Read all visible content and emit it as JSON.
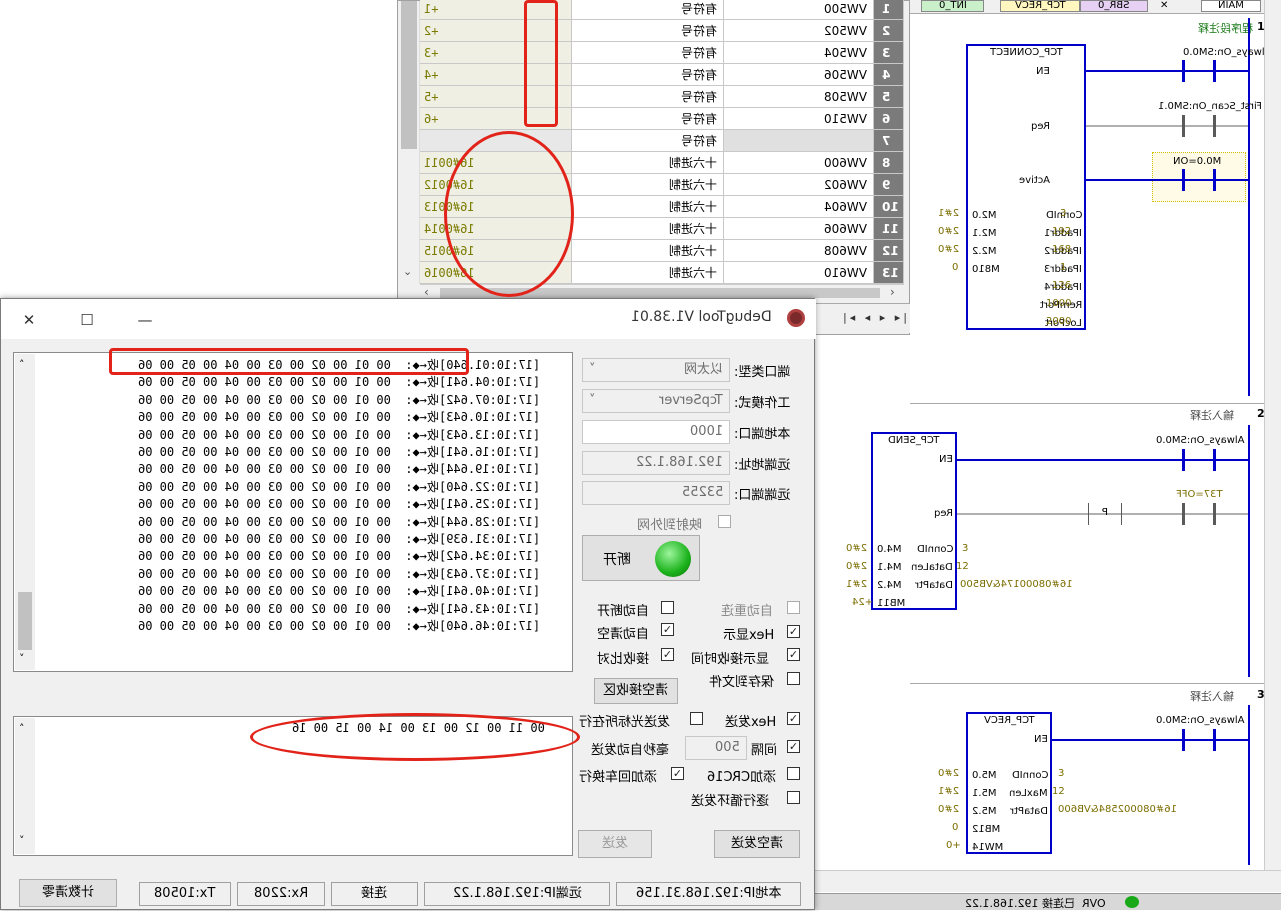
{
  "var_table": {
    "rows": [
      {
        "num": "1",
        "addr": "VW500",
        "fmt": "有符号",
        "val": "+1"
      },
      {
        "num": "2",
        "addr": "VW502",
        "fmt": "有符号",
        "val": "+2"
      },
      {
        "num": "3",
        "addr": "VW504",
        "fmt": "有符号",
        "val": "+3"
      },
      {
        "num": "4",
        "addr": "VW506",
        "fmt": "有符号",
        "val": "+4"
      },
      {
        "num": "5",
        "addr": "VW508",
        "fmt": "有符号",
        "val": "+5"
      },
      {
        "num": "6",
        "addr": "VW510",
        "fmt": "有符号",
        "val": "+6"
      },
      {
        "num": "7",
        "addr": "",
        "fmt": "有符号",
        "val": ""
      },
      {
        "num": "8",
        "addr": "VW600",
        "fmt": "十六进制",
        "val": "16#0011"
      },
      {
        "num": "9",
        "addr": "VW602",
        "fmt": "十六进制",
        "val": "16#0012"
      },
      {
        "num": "10",
        "addr": "VW604",
        "fmt": "十六进制",
        "val": "16#0013"
      },
      {
        "num": "11",
        "addr": "VW606",
        "fmt": "十六进制",
        "val": "16#0014"
      },
      {
        "num": "12",
        "addr": "VW608",
        "fmt": "十六进制",
        "val": "16#0015"
      },
      {
        "num": "13",
        "addr": "VW610",
        "fmt": "十六进制",
        "val": "16#0016"
      }
    ],
    "nav_glyphs": "|◂ ◂ ▸ ▸|"
  },
  "ladder": {
    "tabs": [
      "MAIN",
      "INT_0",
      "TCP_RECV",
      "SBR_0"
    ],
    "networks": [
      {
        "num": "1",
        "comment": "程序段注释",
        "block": "TCP_CONNECT",
        "always": "Always_On:SM0.0",
        "first": "First_Scan_On:SM0.1",
        "m_on": "M0.0=ON",
        "pins": [
          "EN",
          "Req",
          "Active",
          "ConnID",
          "IPaddr1",
          "IPaddr2",
          "IPaddr3",
          "IPaddr4",
          "RemPort",
          "LocPort"
        ],
        "inputs": [
          "3",
          "192",
          "168",
          "1",
          "126",
          "1000",
          "2000"
        ],
        "outputs": [
          "M2.0",
          "M2.1",
          "M2.2",
          "M810"
        ],
        "out_vals": [
          "2#1",
          "2#0",
          "2#0",
          "0"
        ]
      },
      {
        "num": "2",
        "comment": "输入注释",
        "block": "TCP_SEND",
        "always": "Always_On:SM0.0",
        "t37": "T37=OFF",
        "p": "P",
        "pins": [
          "EN",
          "Req",
          "ConnID",
          "DataLen",
          "DataPtr"
        ],
        "inputs": [
          "3",
          "12",
          "16#08000174&VB500"
        ],
        "outputs": [
          "M4.0",
          "M4.1",
          "M4.2",
          "MB11"
        ],
        "out_vals": [
          "2#0",
          "2#0",
          "2#1",
          "+24"
        ]
      },
      {
        "num": "3",
        "comment": "输入注释",
        "block": "TCP_RECV",
        "always": "Always_On:SM0.0",
        "pins": [
          "EN",
          "ConnID",
          "MaxLen",
          "DataPtr"
        ],
        "inputs": [
          "3",
          "12",
          "16#080002584&VB600"
        ],
        "outputs": [
          "M5.0",
          "M5.1",
          "M5.2",
          "MB12",
          "MW14"
        ],
        "out_vals": [
          "2#0",
          "2#1",
          "2#0",
          "0",
          "+0"
        ]
      }
    ],
    "status_bar": "OVR  已连接 192.168.1.22"
  },
  "debug": {
    "title": "DebugTool V1.38.01",
    "minimize": "—",
    "maximize": "☐",
    "close": "✕",
    "rx_lines": [
      "[17:10:01.640]收←◆:  00 01 00 02 00 03 00 04 00 05 00 06",
      "[17:10:04.641]收←◆:  00 01 00 02 00 03 00 04 00 05 00 06",
      "[17:10:07.642]收←◆:  00 01 00 02 00 03 00 04 00 05 00 06",
      "[17:10:10.643]收←◆:  00 01 00 02 00 03 00 04 00 05 00 06",
      "[17:10:13.643]收←◆:  00 01 00 02 00 03 00 04 00 05 00 06",
      "[17:10:16.641]收←◆:  00 01 00 02 00 03 00 04 00 05 00 06",
      "[17:10:19.644]收←◆:  00 01 00 02 00 03 00 04 00 05 00 06",
      "[17:10:22.640]收←◆:  00 01 00 02 00 03 00 04 00 05 00 06",
      "[17:10:25.641]收←◆:  00 01 00 02 00 03 00 04 00 05 00 06",
      "[17:10:28.644]收←◆:  00 01 00 02 00 03 00 04 00 05 00 06",
      "[17:10:31.639]收←◆:  00 01 00 02 00 03 00 04 00 05 00 06",
      "[17:10:34.642]收←◆:  00 01 00 02 00 03 00 04 00 05 00 06",
      "[17:10:37.643]收←◆:  00 01 00 02 00 03 00 04 00 05 00 06",
      "[17:10:40.641]收←◆:  00 01 00 02 00 03 00 04 00 05 00 06",
      "[17:10:43.641]收←◆:  00 01 00 02 00 03 00 04 00 05 00 06",
      "[17:10:46.640]收←◆:  00 01 00 02 00 03 00 04 00 05 00 06"
    ],
    "port_type_label": "端口类型:",
    "port_type": "以太网",
    "work_mode_label": "工作模式:",
    "work_mode": "TcpServer",
    "local_port_label": "本地端口:",
    "local_port": "1000",
    "remote_addr_label": "远端地址:",
    "remote_addr": "192.168.1.22",
    "remote_port_label": "远端端口:",
    "remote_port": "53255",
    "map_label": "映射到外网",
    "disconnect": "断开",
    "auto_reconnect": "自动重连",
    "auto_disconnect": "自动断开",
    "hex_display": "Hex显示",
    "auto_clear": "自动清空",
    "show_time": "显示接收时间",
    "rx_compare": "接收比对",
    "save_file": "保存到文件",
    "clear_rx": "清空接收区",
    "hex_send": "Hex发送",
    "send_cursor": "发送光标所在行",
    "interval": "间隔",
    "interval_val": "500",
    "interval_unit": "毫秒自动发送",
    "crc16": "添加CRC16",
    "add_crlf": "添加回车换行",
    "loop_send": "逐行循环发送",
    "clear_send": "清空发送",
    "send": "发送",
    "tx_text": "00 11 00 12 00 13 00 14 00 15 00 16",
    "status": [
      "本地IP:192.168.31.156",
      "远端IP:192.168.1.22",
      "连接",
      "Rx:2208",
      "Tx:10508",
      "计数清零"
    ]
  }
}
